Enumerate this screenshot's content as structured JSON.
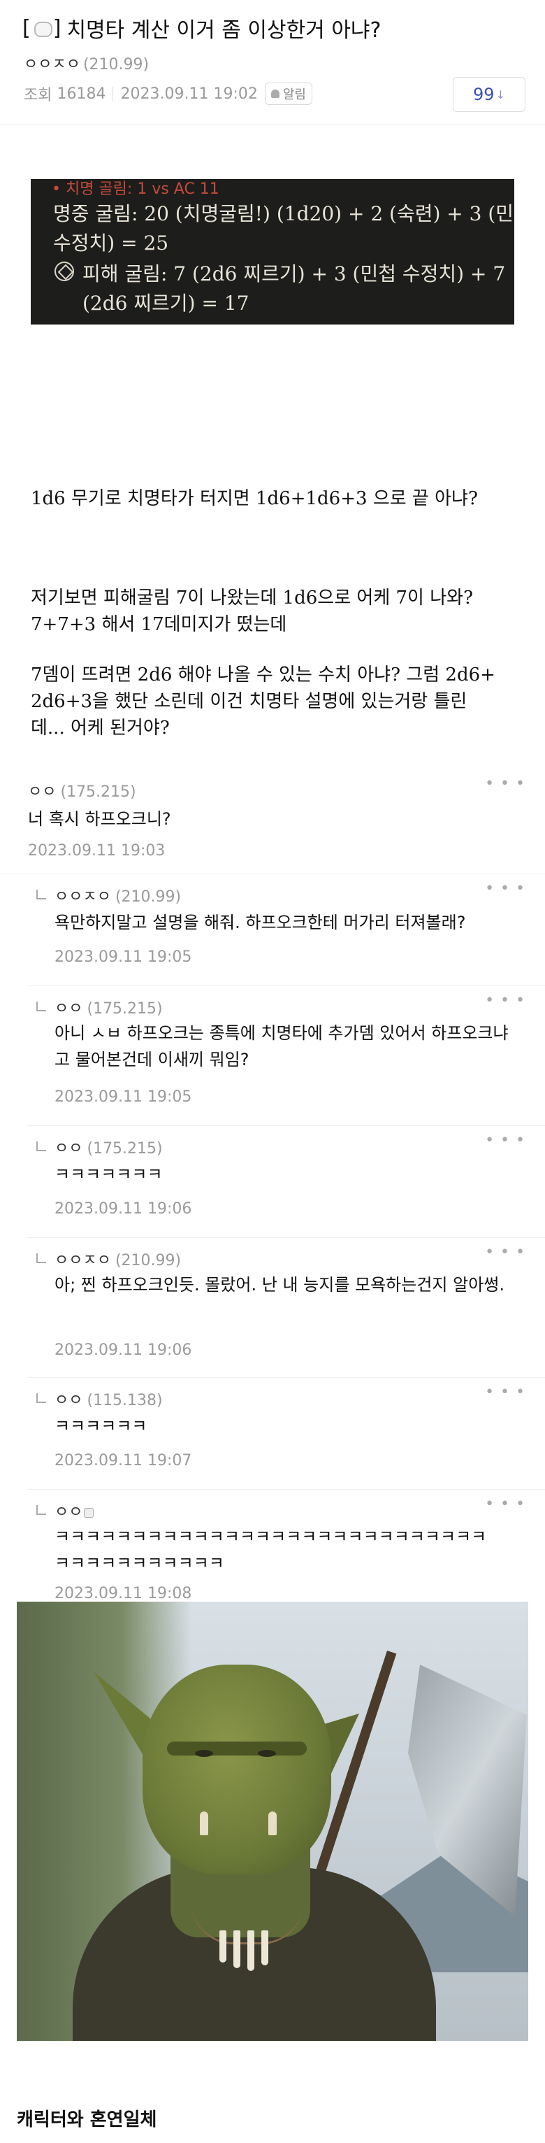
{
  "post": {
    "title_prefix": "[",
    "title_suffix": "]",
    "title": "치명타 계산 이거 좀 이상한거 아냐?",
    "author": "ㅇㅇㅈㅇ",
    "author_ip": "(210.99)",
    "views_label": "조회",
    "views": "16184",
    "datetime": "2023.09.11 19:02",
    "alarm_label": "알림",
    "recommend_count": "99",
    "recommend_arrow": "↓"
  },
  "game_screenshot": {
    "top_partial": "• 치명 골림: 1 vs AC 11",
    "attack_line1": "명중 굴림: 20 (치명굴림!) (1d20) + 2 (숙련) + 3 (민첩",
    "attack_line2": "수정치) = 25",
    "damage_line1": "피해 굴림: 7 (2d6 찌르기) + 3 (민첩 수정치) + 7",
    "damage_line2": "(2d6 찌르기) = 17"
  },
  "body": {
    "p1": "1d6 무기로 치명타가 터지면 1d6+1d6+3 으로 끝 아냐?",
    "p2": "저기보면 피해굴림 7이 나왔는데 1d6으로 어케 7이 나와?",
    "p3": "7+7+3 해서 17데미지가 떴는데",
    "p4": "7뎀이 뜨려면 2d6 해야 나올 수 있는 수치 아냐? 그럼 2d6+",
    "p5": "2d6+3을 했단 소린데 이건 치명타 설명에 있는거랑 틀린",
    "p6": "데... 어케 된거야?"
  },
  "comments": [
    {
      "nick": "ㅇㅇ",
      "ip": "(175.215)",
      "text": "너 혹시 하프오크니?",
      "date": "2023.09.11 19:03"
    },
    {
      "nick": "ㅇㅇㅈㅇ",
      "ip": "(210.99)",
      "text": "욕만하지말고 설명을 해줘. 하프오크한테 머가리 터져볼래?",
      "date": "2023.09.11 19:05"
    },
    {
      "nick": "ㅇㅇ",
      "ip": "(175.215)",
      "text": "아니 ㅅㅂ 하프오크는 종특에 치명타에 추가뎀 있어서 하프오크냐고 물어본건데 이새끼 뭐임?",
      "date": "2023.09.11 19:05"
    },
    {
      "nick": "ㅇㅇ",
      "ip": "(175.215)",
      "text": "ㅋㅋㅋㅋㅋㅋㅋ",
      "date": "2023.09.11 19:06"
    },
    {
      "nick": "ㅇㅇㅈㅇ",
      "ip": "(210.99)",
      "text": "아; 찐 하프오크인듯. 몰랐어. 난 내 능지를 모욕하는건지 알아썽.",
      "date": "2023.09.11 19:06"
    },
    {
      "nick": "ㅇㅇ",
      "ip": "(115.138)",
      "text": "ㅋㅋㅋㅋㅋㅋ",
      "date": "2023.09.11 19:07"
    },
    {
      "nick": "ㅇㅇ",
      "ip": "",
      "text": "ㅋㅋㅋㅋㅋㅋㅋㅋㅋㅋㅋㅋㅋㅋㅋㅋㅋㅋㅋㅋㅋㅋㅋㅋㅋㅋㅋㅋㅋㅋㅋㅋㅋㅋㅋㅋㅋㅋㅋ",
      "date": "2023.09.11 19:08"
    }
  ],
  "more_label": "• • •",
  "caption": "캐릭터와 혼연일체",
  "colors": {
    "accent": "#3a4fb4",
    "meta": "#9a9a9a",
    "game_bg": "#1d1d1b"
  }
}
